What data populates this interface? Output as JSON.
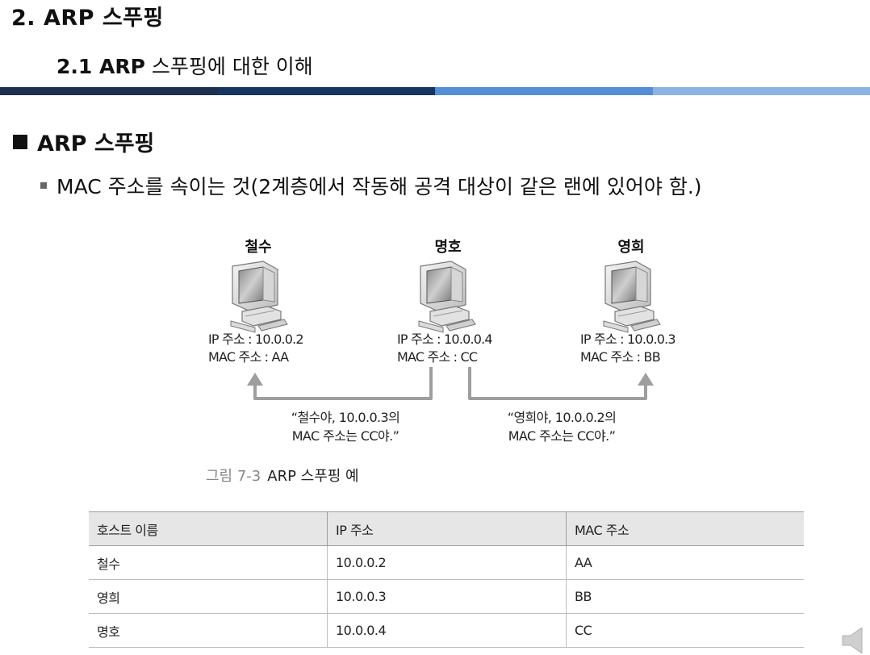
{
  "slide": {
    "chapter_title": "2. ARP 스푸핑",
    "section_num": "2.1 ARP",
    "section_rest": " 스푸핑에 대한 이해",
    "bar_colors": [
      "#1e3050",
      "#17365d",
      "#558ed5",
      "#8db3e2"
    ],
    "topic": "ARP 스푸핑",
    "bullet": "MAC 주소를 속이는 것(2계층에서 작동해 공격 대상이 같은 랜에 있어야 함.)"
  },
  "figure": {
    "hosts": [
      {
        "name": "철수",
        "ip": "IP 주소 : 10.0.0.2",
        "mac": "MAC 주소 : AA"
      },
      {
        "name": "명호",
        "ip": "IP 주소 : 10.0.0.4",
        "mac": "MAC 주소 : CC"
      },
      {
        "name": "영희",
        "ip": "IP 주소 : 10.0.0.3",
        "mac": "MAC 주소 : BB"
      }
    ],
    "messages": [
      {
        "line1": "“철수야, 10.0.0.3의",
        "line2": "MAC 주소는 CC야.”"
      },
      {
        "line1": "“영희야, 10.0.0.2의",
        "line2": "MAC 주소는 CC야.”"
      }
    ],
    "caption_label": "그림 7-3",
    "caption_text": "ARP 스푸핑 예"
  },
  "table": {
    "headers": [
      "호스트 이름",
      "IP 주소",
      "MAC 주소"
    ],
    "rows": [
      [
        "철수",
        "10.0.0.2",
        "AA"
      ],
      [
        "영희",
        "10.0.0.3",
        "BB"
      ],
      [
        "명호",
        "10.0.0.4",
        "CC"
      ]
    ]
  },
  "icons": {
    "computer": "computer-icon",
    "speaker": "speaker-icon",
    "arrow": "arrow-up-icon"
  }
}
